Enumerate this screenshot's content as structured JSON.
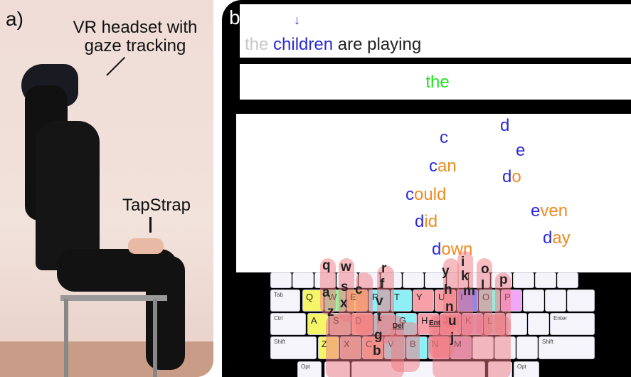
{
  "panel_a": {
    "label": "a)",
    "headset_label": "VR headset with gaze tracking",
    "tapstrap_label": "TapStrap"
  },
  "panel_b": {
    "label": "b)",
    "arrow": "↓",
    "sentence": {
      "done": "the",
      "current": "children",
      "rest": "are playing"
    },
    "typed": "the",
    "suggestions": [
      {
        "first": "c",
        "rest": ""
      },
      {
        "first": "d",
        "rest": ""
      },
      {
        "first": "e",
        "rest": ""
      },
      {
        "first": "c",
        "rest": "an"
      },
      {
        "first": "d",
        "rest": "o"
      },
      {
        "first": "c",
        "rest": "ould"
      },
      {
        "first": "d",
        "rest": "id"
      },
      {
        "first": "e",
        "rest": "ven"
      },
      {
        "first": "d",
        "rest": "own"
      },
      {
        "first": "d",
        "rest": "ay"
      }
    ],
    "keys": {
      "tab": "Tab",
      "ctrl": "Ctrl",
      "enter": "Enter",
      "shift": "Shift",
      "shift_r": "Shift",
      "opt": "Opt",
      "opt_r": "Opt",
      "row1": [
        "Q",
        "W",
        "E",
        "R",
        "T",
        "Y",
        "U",
        "I",
        "O",
        "P"
      ],
      "row2": [
        "A",
        "S",
        "D",
        "F",
        "G",
        "H",
        "J",
        "K",
        "L"
      ],
      "row3": [
        "Z",
        "X",
        "C",
        "V",
        "B",
        "N",
        "M"
      ]
    },
    "left_fingers": [
      "q",
      "w",
      "a",
      "s",
      "x",
      "z",
      "c",
      "r",
      "f",
      "v",
      "t",
      "g",
      "b",
      "Del"
    ],
    "right_fingers": [
      "y",
      "h",
      "n",
      "u",
      "j",
      "i",
      "k",
      "m",
      "o",
      "l",
      "p",
      "Ent"
    ]
  },
  "colors": {
    "blue": "#2a2ad8",
    "orange": "#f08a20",
    "green": "#22e022"
  }
}
